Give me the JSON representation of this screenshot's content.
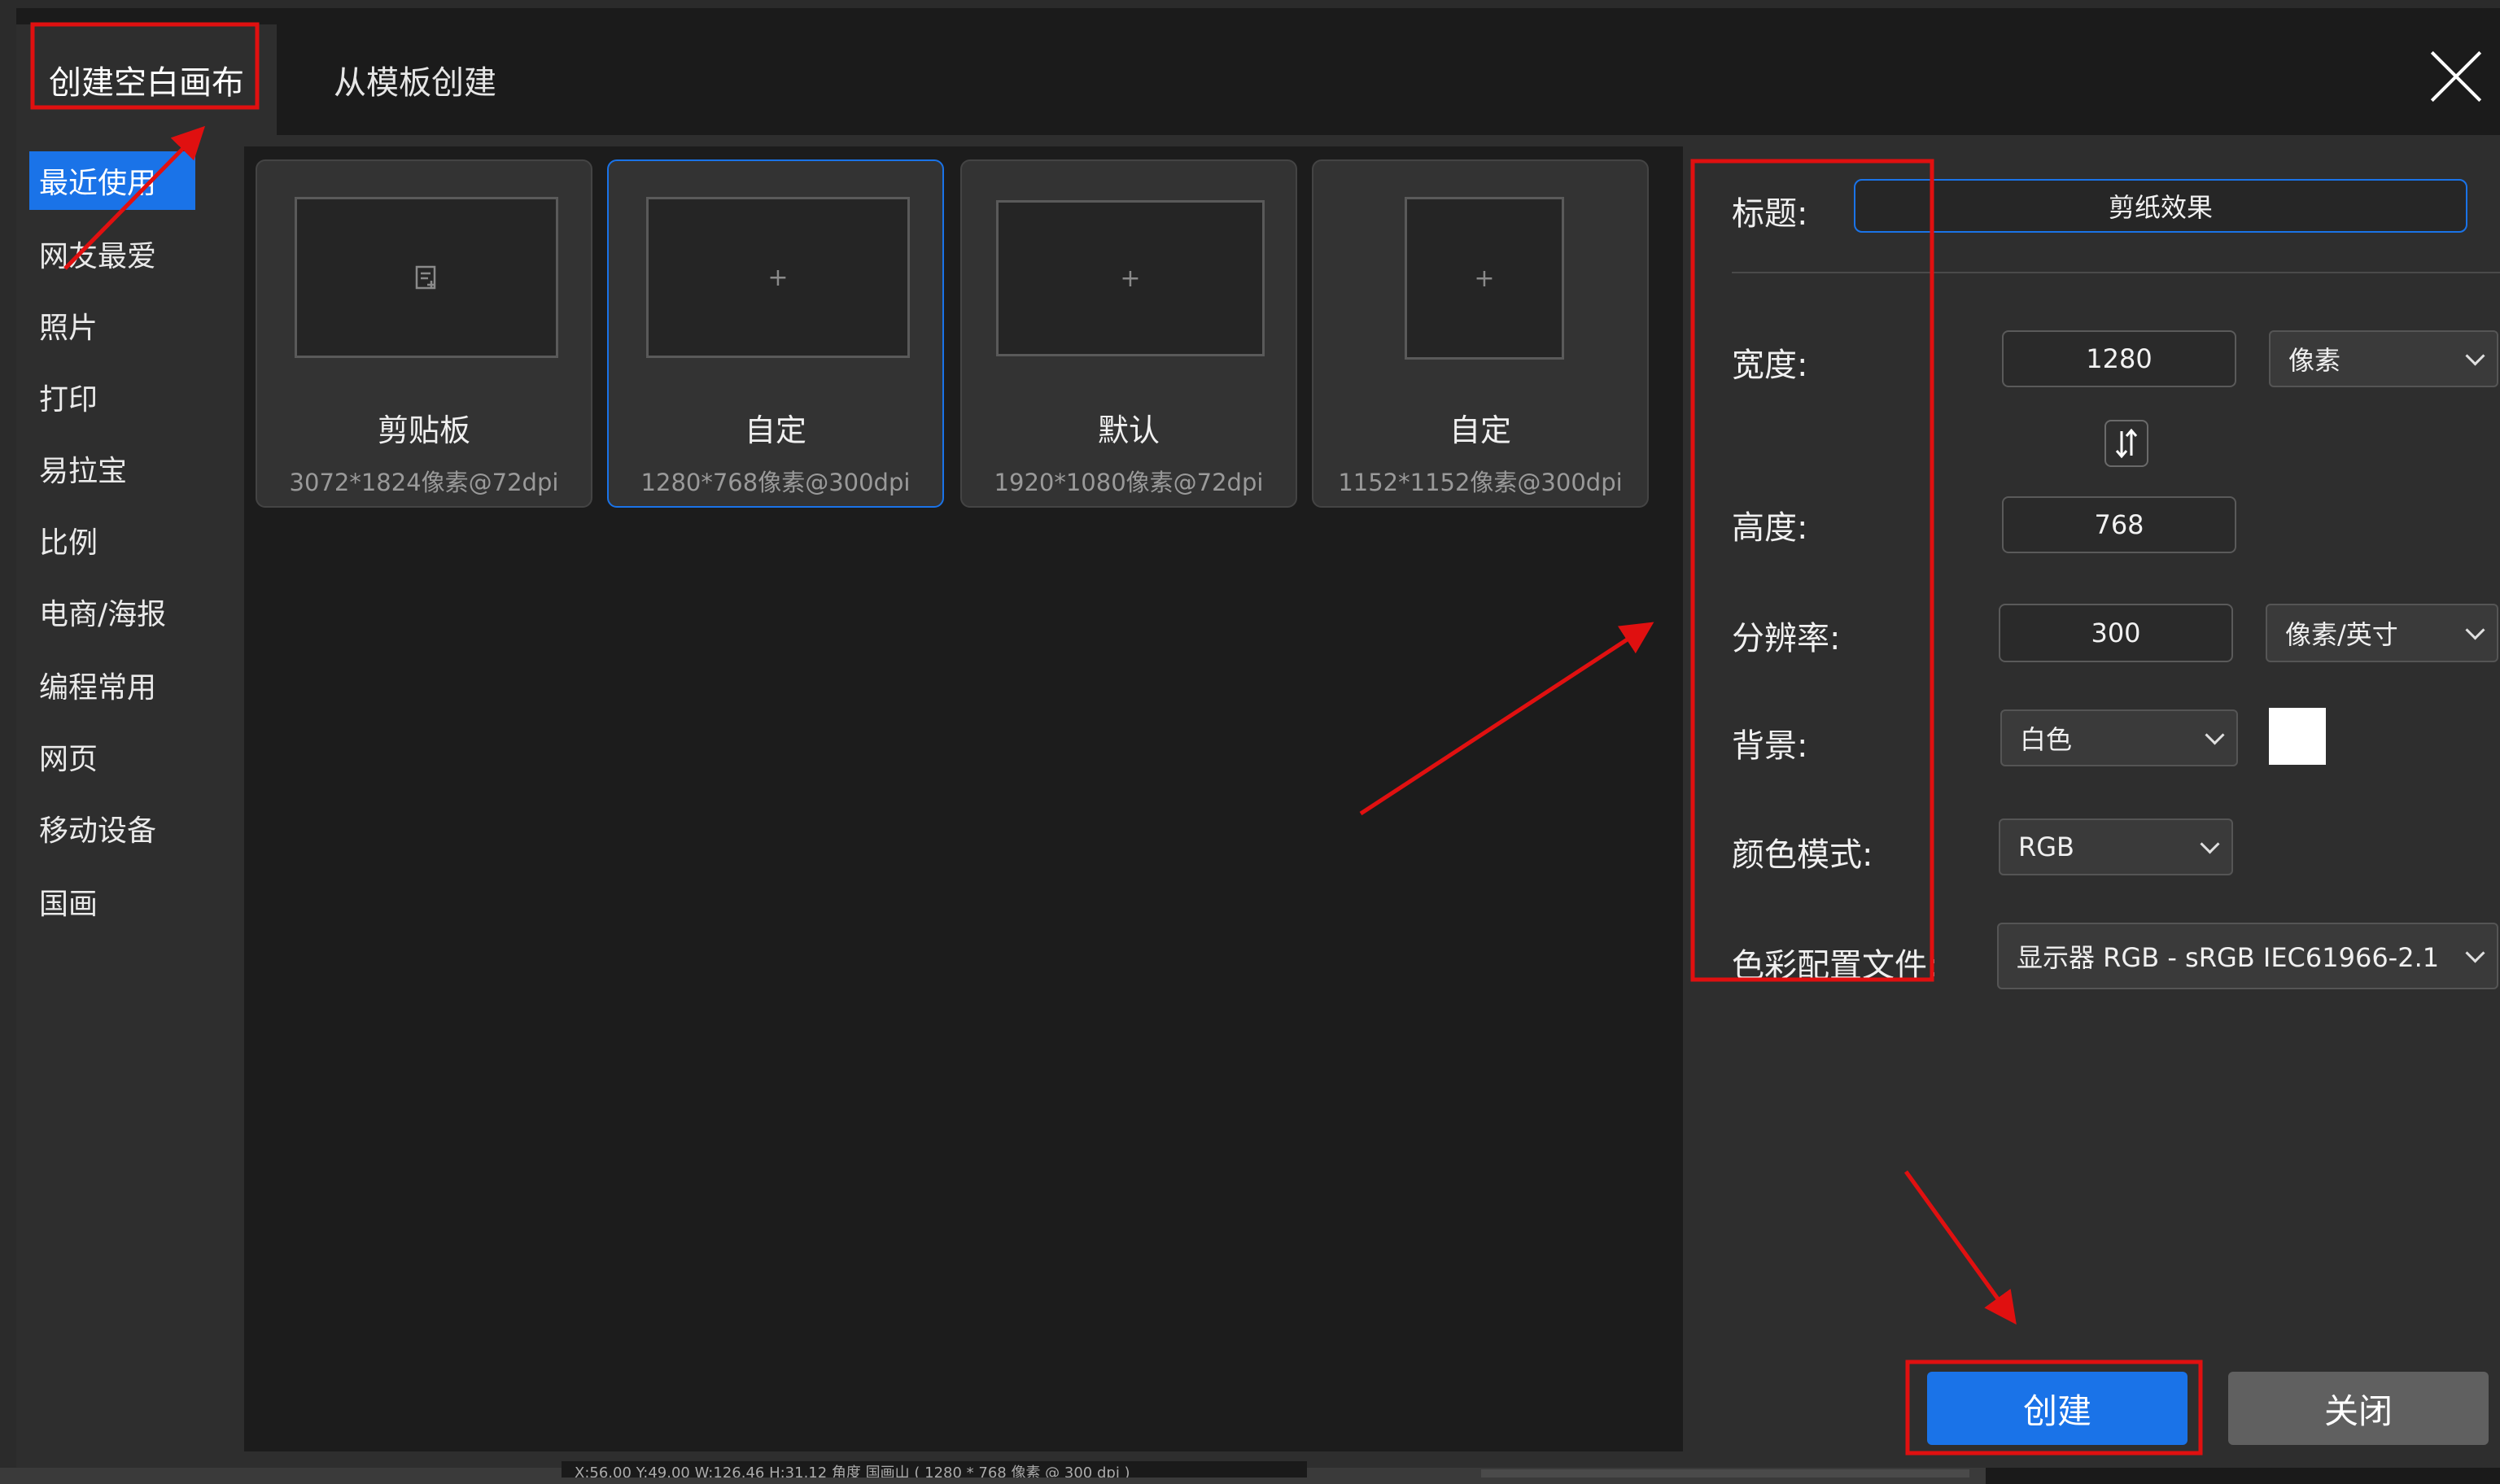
{
  "tabs": {
    "blank_canvas": "创建空白画布",
    "from_template": "从模板创建"
  },
  "sidebar": {
    "items": [
      {
        "label": "最近使用"
      },
      {
        "label": "网友最爱"
      },
      {
        "label": "照片"
      },
      {
        "label": "打印"
      },
      {
        "label": "易拉宝"
      },
      {
        "label": "比例"
      },
      {
        "label": "电商/海报"
      },
      {
        "label": "编程常用"
      },
      {
        "label": "网页"
      },
      {
        "label": "移动设备"
      },
      {
        "label": "国画"
      }
    ]
  },
  "templates": [
    {
      "name": "剪贴板",
      "size": "3072*1824像素@72dpi",
      "icon": "clipboard-icon"
    },
    {
      "name": "自定",
      "size": "1280*768像素@300dpi",
      "icon": "plus-icon"
    },
    {
      "name": "默认",
      "size": "1920*1080像素@72dpi",
      "icon": "plus-icon"
    },
    {
      "name": "自定",
      "size": "1152*1152像素@300dpi",
      "icon": "plus-icon"
    }
  ],
  "props": {
    "title_label": "标题:",
    "title_value": "剪纸效果",
    "width_label": "宽度:",
    "width_value": "1280",
    "width_unit": "像素",
    "height_label": "高度:",
    "height_value": "768",
    "resolution_label": "分辨率:",
    "resolution_value": "300",
    "resolution_unit": "像素/英寸",
    "background_label": "背景:",
    "background_value": "白色",
    "color_mode_label": "颜色模式:",
    "color_mode_value": "RGB",
    "profile_label": "色彩配置文件:",
    "profile_value": "显示器 RGB - sRGB IEC61966-2.1"
  },
  "buttons": {
    "create": "创建",
    "close": "关闭"
  },
  "statusbar": {
    "text": "X:56.00 Y:49.00 W:126.46 H:31.12 角度 国画山 ( 1280 * 768 像素 @ 300 dpi )"
  },
  "colors": {
    "accent": "#1a73e8",
    "annotation": "#e01010",
    "background_swatch": "#ffffff"
  }
}
